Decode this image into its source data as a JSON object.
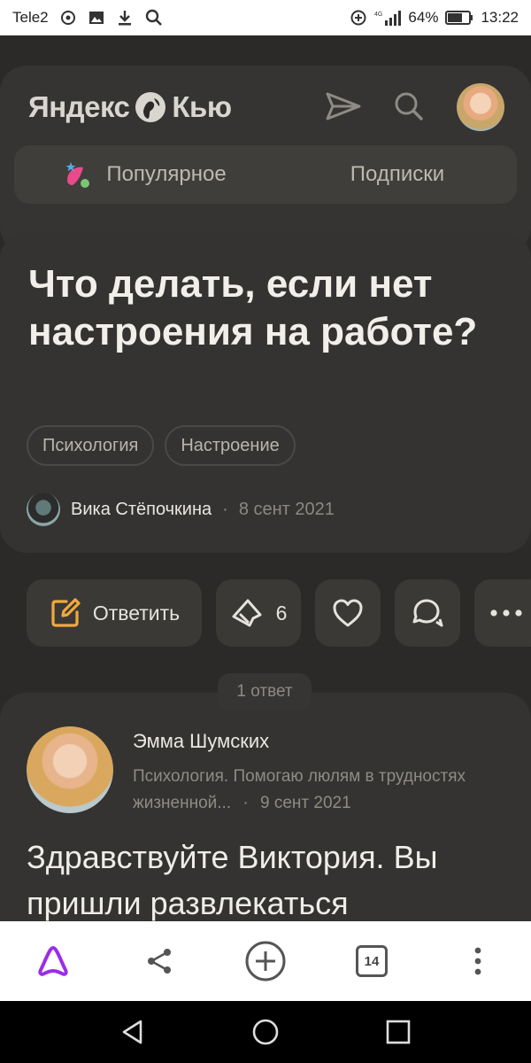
{
  "status_bar": {
    "carrier": "Tele2",
    "network": "4G",
    "battery": "64%",
    "time": "13:22",
    "left_icons": [
      "hotspot-icon",
      "image-icon",
      "download-icon",
      "search-icon"
    ],
    "right_icons": [
      "data-saver-icon",
      "signal-icon",
      "battery-icon"
    ]
  },
  "header": {
    "logo_left": "Яндекс",
    "logo_right": "Кью",
    "icons": [
      "send-icon",
      "search-icon",
      "avatar"
    ]
  },
  "tabs": {
    "popular": "Популярное",
    "subscriptions": "Подписки"
  },
  "question": {
    "title": "Что делать, если нет настроения на работе?",
    "tags": [
      "Психология",
      "Настроение"
    ],
    "author": "Вика Стёпочкина",
    "separator": "·",
    "date": "8 сент 2021"
  },
  "actions": {
    "answer_label": "Ответить",
    "upvote_count": "6"
  },
  "answers_count": "1 ответ",
  "answer": {
    "author": "Эмма Шумских",
    "bio": "Психология. Помогаю люлям в трудностях жизненной...",
    "separator": "·",
    "date": "9 сент 2021",
    "text": "Здравствуйте Виктория. Вы пришли развлекаться"
  },
  "browser_bar": {
    "tabs_count": "14",
    "icons": [
      "alice-icon",
      "share-icon",
      "add-icon",
      "tabs-icon",
      "more-vertical-icon"
    ]
  },
  "colors": {
    "background": "#2b2a28",
    "card": "#343331",
    "accent_orange": "#f2a93b",
    "alice_purple": "#9b2de8"
  }
}
